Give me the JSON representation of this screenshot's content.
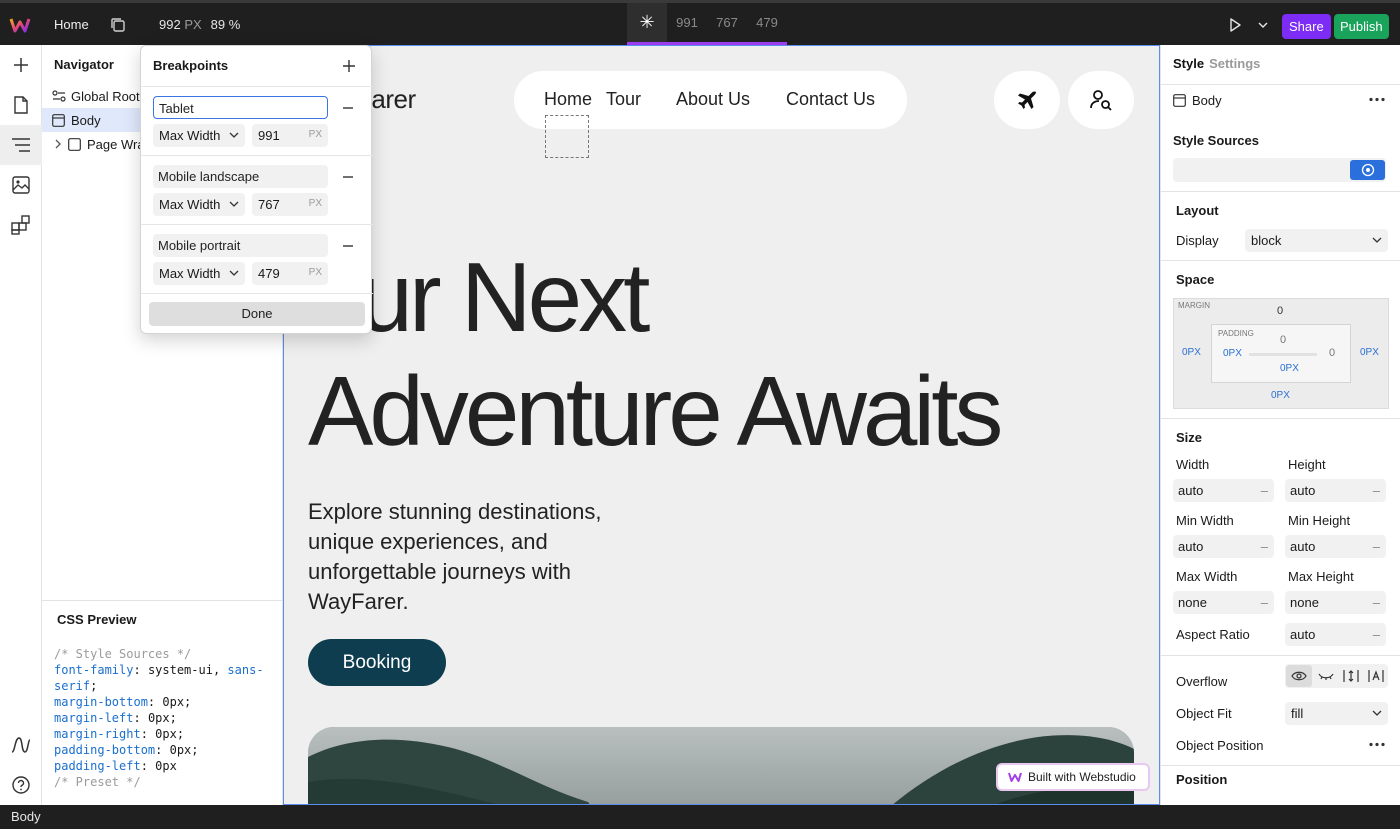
{
  "topbar": {
    "page_name": "Home",
    "canvas_width": "992",
    "canvas_unit": "PX",
    "zoom": "89 %",
    "breakpoints": [
      "991",
      "767",
      "479"
    ],
    "share_label": "Share",
    "publish_label": "Publish",
    "accent_color": "#9b3cf0"
  },
  "navigator": {
    "title": "Navigator",
    "items": [
      "Global Root",
      "Body",
      "Page Wra"
    ],
    "css_preview_title": "CSS Preview",
    "css_lines": [
      {
        "comment": "/* Style Sources */"
      },
      {
        "prop": "font-family",
        "value": "system-ui, ",
        "kw": "sans-",
        "kw2": "serif",
        "end": ";"
      },
      {
        "prop": "margin-bottom",
        "value": "0px;"
      },
      {
        "prop": "margin-left",
        "value": "0px;"
      },
      {
        "prop": "margin-right",
        "value": "0px;"
      },
      {
        "prop": "padding-bottom",
        "value": "0px;"
      },
      {
        "prop": "padding-left",
        "value": "0px"
      },
      {
        "comment": "/* Preset */"
      }
    ]
  },
  "breakpoints_popover": {
    "title": "Breakpoints",
    "rows": [
      {
        "name": "Tablet",
        "condition": "Max Width",
        "value": "991",
        "unit": "PX"
      },
      {
        "name": "Mobile landscape",
        "condition": "Max Width",
        "value": "767",
        "unit": "PX"
      },
      {
        "name": "Mobile portrait",
        "condition": "Max Width",
        "value": "479",
        "unit": "PX"
      }
    ],
    "done_label": "Done"
  },
  "site": {
    "logo_text": "Farer",
    "nav": [
      "Home",
      "Tour",
      "About Us",
      "Contact Us"
    ],
    "hero_line1": "our Next",
    "hero_line2": "Adventure Awaits",
    "subtitle": "Explore stunning destinations, unique experiences, and unforgettable journeys with WayFarer.",
    "cta": "Booking",
    "badge": "Built with Webstudio",
    "cta_color": "#0d3d4f"
  },
  "style_panel": {
    "tab_style": "Style",
    "tab_settings": "Settings",
    "element": "Body",
    "style_sources": "Style Sources",
    "layout": "Layout",
    "display_label": "Display",
    "display_value": "block",
    "space": "Space",
    "margin_label": "MARGIN",
    "padding_label": "PADDING",
    "margin_top": "0",
    "padding_top": "0",
    "padding_right": "0",
    "px_values": "0PX",
    "size": "Size",
    "width_label": "Width",
    "height_label": "Height",
    "min_width_label": "Min Width",
    "min_height_label": "Min Height",
    "max_width_label": "Max Width",
    "max_height_label": "Max Height",
    "aspect_ratio_label": "Aspect Ratio",
    "width": "auto",
    "height": "auto",
    "min_width": "auto",
    "min_height": "auto",
    "max_width": "none",
    "max_height": "none",
    "aspect_ratio": "auto",
    "overflow_label": "Overflow",
    "object_fit_label": "Object Fit",
    "object_fit": "fill",
    "object_position_label": "Object Position",
    "position": "Position"
  },
  "statusbar": {
    "text": "Body"
  }
}
